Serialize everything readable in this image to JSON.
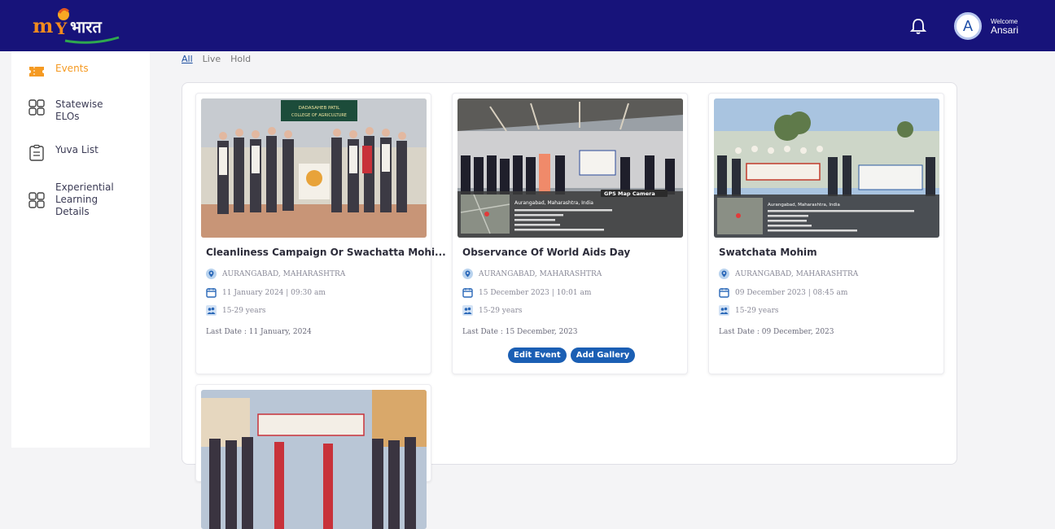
{
  "header": {
    "logo_text": "mY भारत",
    "welcome_label": "Welcome",
    "user_name": "Ansari",
    "avatar_initial": "A"
  },
  "sidebar": {
    "items": [
      {
        "label": "Events",
        "icon": "ticket-icon",
        "active": true
      },
      {
        "label": "Statewise ELOs",
        "icon": "grid-icon"
      },
      {
        "label": "Yuva List",
        "icon": "clipboard-icon"
      },
      {
        "label": "Experiential Learning Details",
        "icon": "grid-icon"
      }
    ]
  },
  "tabs": [
    {
      "label": "All",
      "active": true
    },
    {
      "label": "Live"
    },
    {
      "label": "Hold"
    }
  ],
  "events": [
    {
      "title": "Cleanliness Campaign Or Swachatta Mohi...",
      "location": "AURANGABAD, MAHARASHTRA",
      "datetime": "11 January 2024 | 09:30 am",
      "age": "15-29 years",
      "last_date": "Last Date : 11 January, 2024",
      "photo_banner": "DADASAHEB PATIL COLLEGE OF AGRICULTURE"
    },
    {
      "title": "Observance Of World Aids Day",
      "location": "AURANGABAD, MAHARASHTRA",
      "datetime": "15 December 2023 | 10:01 am",
      "age": "15-29 years",
      "last_date": "Last Date : 15 December, 2023",
      "photo_banner": "GPS Map Camera",
      "photo_caption": "Aurangabad, Maharashtra, India",
      "edit_label": "Edit Event",
      "gallery_label": "Add Gallery"
    },
    {
      "title": "Swatchata Mohim",
      "location": "AURANGABAD, MAHARASHTRA",
      "datetime": "09 December 2023 | 08:45 am",
      "age": "15-29 years",
      "last_date": "Last Date : 09 December, 2023",
      "photo_caption": "Aurangabad, Maharashtra, India"
    }
  ],
  "colors": {
    "header_bg": "#17137a",
    "accent_orange": "#f59a22",
    "primary_blue": "#1b5fb4"
  }
}
